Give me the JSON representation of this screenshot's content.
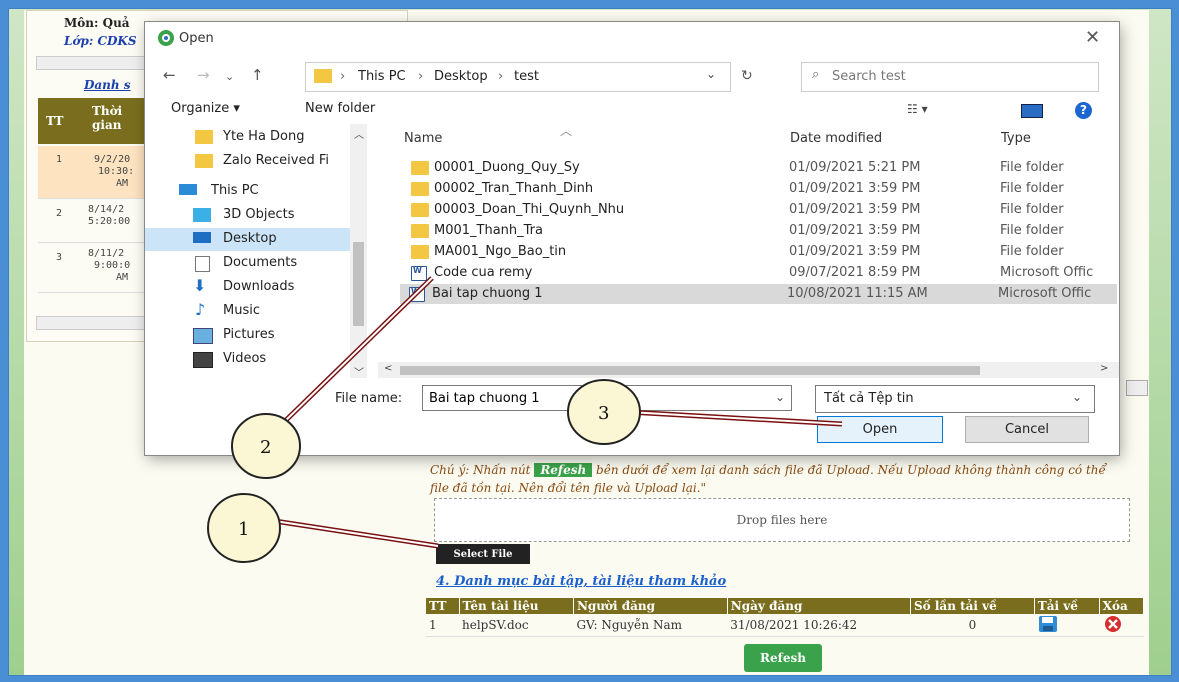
{
  "background": {
    "subject_label": "Môn: Quả",
    "class_label": "Lớp: CDKS",
    "list_title": "Danh s",
    "table_headers": [
      "TT",
      "Thời gian"
    ],
    "rows": [
      {
        "tt": "1",
        "time_l1": "9/2/20",
        "time_l2": "10:30:",
        "time_l3": "AM"
      },
      {
        "tt": "2",
        "time_l1": "8/14/2",
        "time_l2": "5:20:00",
        "time_l3": ""
      },
      {
        "tt": "3",
        "time_l1": "8/11/2",
        "time_l2": "9:00:0",
        "time_l3": "AM"
      }
    ],
    "note_prefix": "Chú ý: Nhấn nút",
    "note_refesh": "Refesh",
    "note_suffix": "bên dưới để xem lại danh sách file đã Upload. Nếu Upload không thành công có thể file đã tồn tại. Nên đổi tên file và Upload lại.\"",
    "drop_zone": "Drop files here",
    "select_file": "Select File",
    "section4_title": "4. Danh mục bài tập, tài liệu tham khảo",
    "doc_headers": [
      "TT",
      "Tên tài liệu",
      "Người đăng",
      "Ngày đăng",
      "Số lần tải về",
      "Tải về",
      "Xóa"
    ],
    "docs": [
      {
        "tt": "1",
        "name": "helpSV.doc",
        "poster": "GV: Nguyễn Nam",
        "date": "31/08/2021 10:26:42",
        "downloads": "0"
      }
    ],
    "refesh_button": "Refesh"
  },
  "dialog": {
    "title": "Open",
    "breadcrumb": [
      "This PC",
      "Desktop",
      "test"
    ],
    "search_placeholder": "Search test",
    "organize": "Organize ▾",
    "new_folder": "New folder",
    "nav_tree": [
      {
        "label": "Yte Ha Dong",
        "icon": "folder-icon",
        "indent": 1
      },
      {
        "label": "Zalo Received Fi",
        "icon": "folder-icon",
        "indent": 1
      },
      {
        "label": "This PC",
        "icon": "monitor-icon",
        "indent": 0
      },
      {
        "label": "3D Objects",
        "icon": "cube-icon",
        "indent": 1
      },
      {
        "label": "Desktop",
        "icon": "desktop-icon",
        "indent": 1,
        "selected": true
      },
      {
        "label": "Documents",
        "icon": "document-icon",
        "indent": 1
      },
      {
        "label": "Downloads",
        "icon": "download-icon",
        "indent": 1
      },
      {
        "label": "Music",
        "icon": "music-icon",
        "indent": 1
      },
      {
        "label": "Pictures",
        "icon": "pictures-icon",
        "indent": 1
      },
      {
        "label": "Videos",
        "icon": "videos-icon",
        "indent": 1
      }
    ],
    "columns": [
      "Name",
      "Date modified",
      "Type"
    ],
    "files": [
      {
        "name": "00001_Duong_Quy_Sy",
        "date": "01/09/2021 5:21 PM",
        "type": "File folder",
        "icon": "folder-icon"
      },
      {
        "name": "00002_Tran_Thanh_Dinh",
        "date": "01/09/2021 3:59 PM",
        "type": "File folder",
        "icon": "folder-icon"
      },
      {
        "name": "00003_Doan_Thi_Quynh_Nhu",
        "date": "01/09/2021 3:59 PM",
        "type": "File folder",
        "icon": "folder-icon"
      },
      {
        "name": "M001_Thanh_Tra",
        "date": "01/09/2021 3:59 PM",
        "type": "File folder",
        "icon": "folder-icon"
      },
      {
        "name": "MA001_Ngo_Bao_tin",
        "date": "01/09/2021 3:59 PM",
        "type": "File folder",
        "icon": "folder-icon"
      },
      {
        "name": "Code cua remy",
        "date": "09/07/2021 8:59 PM",
        "type": "Microsoft Offic",
        "icon": "word-doc-icon"
      },
      {
        "name": "Bai tap chuong 1",
        "date": "10/08/2021 11:15 AM",
        "type": "Microsoft Offic",
        "icon": "word-doc-icon",
        "selected": true
      }
    ],
    "file_name_label": "File name:",
    "file_name_value": "Bai tap chuong 1",
    "file_type": "Tất cả Tệp tin",
    "open_button": "Open",
    "cancel_button": "Cancel"
  },
  "annotations": [
    "1",
    "2",
    "3"
  ],
  "colors": {
    "accent": "#0078d7",
    "table_header": "#7a6e1e",
    "refesh_green": "#3aa24a",
    "folder": "#f4c742"
  }
}
